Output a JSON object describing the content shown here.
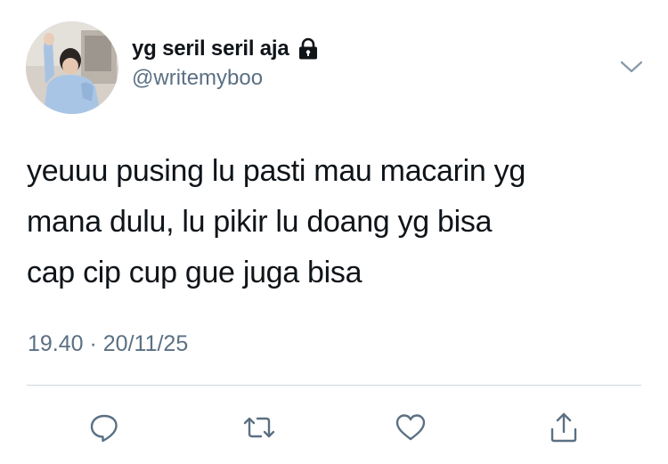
{
  "author": {
    "display_name": "yg seril seril aja",
    "handle": "@writemyboo",
    "protected_icon": "lock-icon",
    "avatar": "profile-photo"
  },
  "tweet": {
    "text": "yeuuu pusing lu pasti mau macarin yg\nmana dulu, lu pikir lu doang yg bisa\ncap cip cup gue juga bisa",
    "timestamp": "19.40 · 20/11/25"
  },
  "actions": {
    "reply_icon": "reply-icon",
    "retweet_icon": "retweet-icon",
    "like_icon": "heart-icon",
    "share_icon": "share-icon"
  },
  "colors": {
    "text_primary": "#0f1419",
    "text_secondary": "#5b7083",
    "divider": "#cfd9de"
  }
}
